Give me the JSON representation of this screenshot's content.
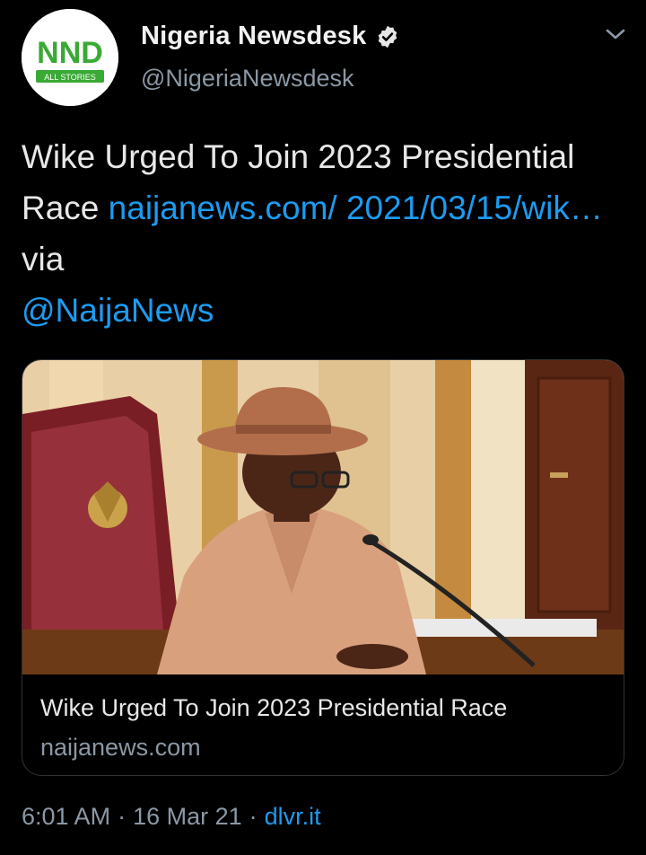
{
  "author": {
    "display_name": "Nigeria Newsdesk",
    "handle": "@NigeriaNewsdesk",
    "avatar_logo_text": "NND",
    "avatar_sub_text": "ALL STORIES",
    "verified_icon": "verified-badge-icon"
  },
  "tweet": {
    "text_plain": "Wike Urged To Join 2023 Presidential Race",
    "link_text": "naijanews.com/ 2021/03/15/wik…",
    "via_text": "via",
    "mention": "@NaijaNews"
  },
  "card": {
    "title": "Wike Urged To Join 2023 Presidential Race",
    "domain": "naijanews.com"
  },
  "meta": {
    "time": "6:01 AM",
    "separator1": "·",
    "date": "16 Mar 21",
    "separator2": "·",
    "source": "dlvr.it"
  },
  "colors": {
    "background": "#000000",
    "link": "#1d9bf0",
    "secondary_text": "#8b98a5",
    "logo_green": "#3aa935"
  }
}
